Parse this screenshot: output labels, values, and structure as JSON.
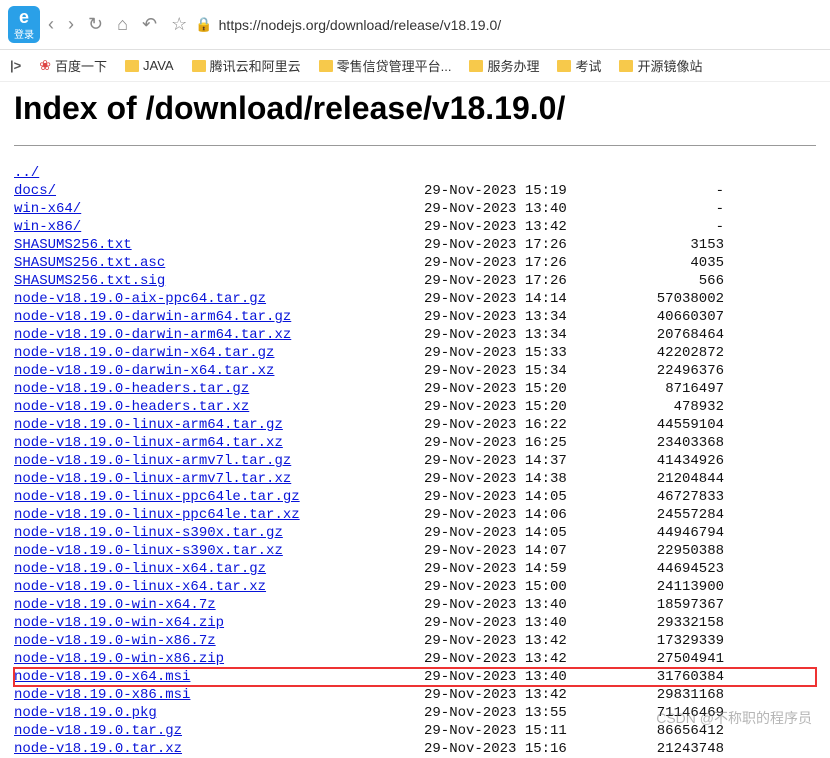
{
  "toolbar": {
    "loginLabel": "登录",
    "url": "https://nodejs.org/download/release/v18.19.0/"
  },
  "bookmarks": [
    {
      "type": "pipe",
      "label": "|>"
    },
    {
      "type": "paw",
      "label": "百度一下"
    },
    {
      "type": "folder",
      "label": "JAVA"
    },
    {
      "type": "folder",
      "label": "腾讯云和阿里云"
    },
    {
      "type": "folder",
      "label": "零售信贷管理平台..."
    },
    {
      "type": "folder",
      "label": "服务办理"
    },
    {
      "type": "folder",
      "label": "考试"
    },
    {
      "type": "folder",
      "label": "开源镜像站"
    }
  ],
  "pageTitle": "Index of /download/release/v18.19.0/",
  "files": [
    {
      "name": "../",
      "date": "",
      "size": ""
    },
    {
      "name": "docs/",
      "date": "29-Nov-2023 15:19",
      "size": "-"
    },
    {
      "name": "win-x64/",
      "date": "29-Nov-2023 13:40",
      "size": "-"
    },
    {
      "name": "win-x86/",
      "date": "29-Nov-2023 13:42",
      "size": "-"
    },
    {
      "name": "SHASUMS256.txt",
      "date": "29-Nov-2023 17:26",
      "size": "3153"
    },
    {
      "name": "SHASUMS256.txt.asc",
      "date": "29-Nov-2023 17:26",
      "size": "4035"
    },
    {
      "name": "SHASUMS256.txt.sig",
      "date": "29-Nov-2023 17:26",
      "size": "566"
    },
    {
      "name": "node-v18.19.0-aix-ppc64.tar.gz",
      "date": "29-Nov-2023 14:14",
      "size": "57038002"
    },
    {
      "name": "node-v18.19.0-darwin-arm64.tar.gz",
      "date": "29-Nov-2023 13:34",
      "size": "40660307"
    },
    {
      "name": "node-v18.19.0-darwin-arm64.tar.xz",
      "date": "29-Nov-2023 13:34",
      "size": "20768464"
    },
    {
      "name": "node-v18.19.0-darwin-x64.tar.gz",
      "date": "29-Nov-2023 15:33",
      "size": "42202872"
    },
    {
      "name": "node-v18.19.0-darwin-x64.tar.xz",
      "date": "29-Nov-2023 15:34",
      "size": "22496376"
    },
    {
      "name": "node-v18.19.0-headers.tar.gz",
      "date": "29-Nov-2023 15:20",
      "size": "8716497"
    },
    {
      "name": "node-v18.19.0-headers.tar.xz",
      "date": "29-Nov-2023 15:20",
      "size": "478932"
    },
    {
      "name": "node-v18.19.0-linux-arm64.tar.gz",
      "date": "29-Nov-2023 16:22",
      "size": "44559104"
    },
    {
      "name": "node-v18.19.0-linux-arm64.tar.xz",
      "date": "29-Nov-2023 16:25",
      "size": "23403368"
    },
    {
      "name": "node-v18.19.0-linux-armv7l.tar.gz",
      "date": "29-Nov-2023 14:37",
      "size": "41434926"
    },
    {
      "name": "node-v18.19.0-linux-armv7l.tar.xz",
      "date": "29-Nov-2023 14:38",
      "size": "21204844"
    },
    {
      "name": "node-v18.19.0-linux-ppc64le.tar.gz",
      "date": "29-Nov-2023 14:05",
      "size": "46727833"
    },
    {
      "name": "node-v18.19.0-linux-ppc64le.tar.xz",
      "date": "29-Nov-2023 14:06",
      "size": "24557284"
    },
    {
      "name": "node-v18.19.0-linux-s390x.tar.gz",
      "date": "29-Nov-2023 14:05",
      "size": "44946794"
    },
    {
      "name": "node-v18.19.0-linux-s390x.tar.xz",
      "date": "29-Nov-2023 14:07",
      "size": "22950388"
    },
    {
      "name": "node-v18.19.0-linux-x64.tar.gz",
      "date": "29-Nov-2023 14:59",
      "size": "44694523"
    },
    {
      "name": "node-v18.19.0-linux-x64.tar.xz",
      "date": "29-Nov-2023 15:00",
      "size": "24113900"
    },
    {
      "name": "node-v18.19.0-win-x64.7z",
      "date": "29-Nov-2023 13:40",
      "size": "18597367"
    },
    {
      "name": "node-v18.19.0-win-x64.zip",
      "date": "29-Nov-2023 13:40",
      "size": "29332158"
    },
    {
      "name": "node-v18.19.0-win-x86.7z",
      "date": "29-Nov-2023 13:42",
      "size": "17329339"
    },
    {
      "name": "node-v18.19.0-win-x86.zip",
      "date": "29-Nov-2023 13:42",
      "size": "27504941"
    },
    {
      "name": "node-v18.19.0-x64.msi",
      "date": "29-Nov-2023 13:40",
      "size": "31760384",
      "hl": true
    },
    {
      "name": "node-v18.19.0-x86.msi",
      "date": "29-Nov-2023 13:42",
      "size": "29831168"
    },
    {
      "name": "node-v18.19.0.pkg",
      "date": "29-Nov-2023 13:55",
      "size": "71146469"
    },
    {
      "name": "node-v18.19.0.tar.gz",
      "date": "29-Nov-2023 15:11",
      "size": "86656412"
    },
    {
      "name": "node-v18.19.0.tar.xz",
      "date": "29-Nov-2023 15:16",
      "size": "21243748"
    }
  ],
  "watermark": "CSDN @不称职的程序员"
}
